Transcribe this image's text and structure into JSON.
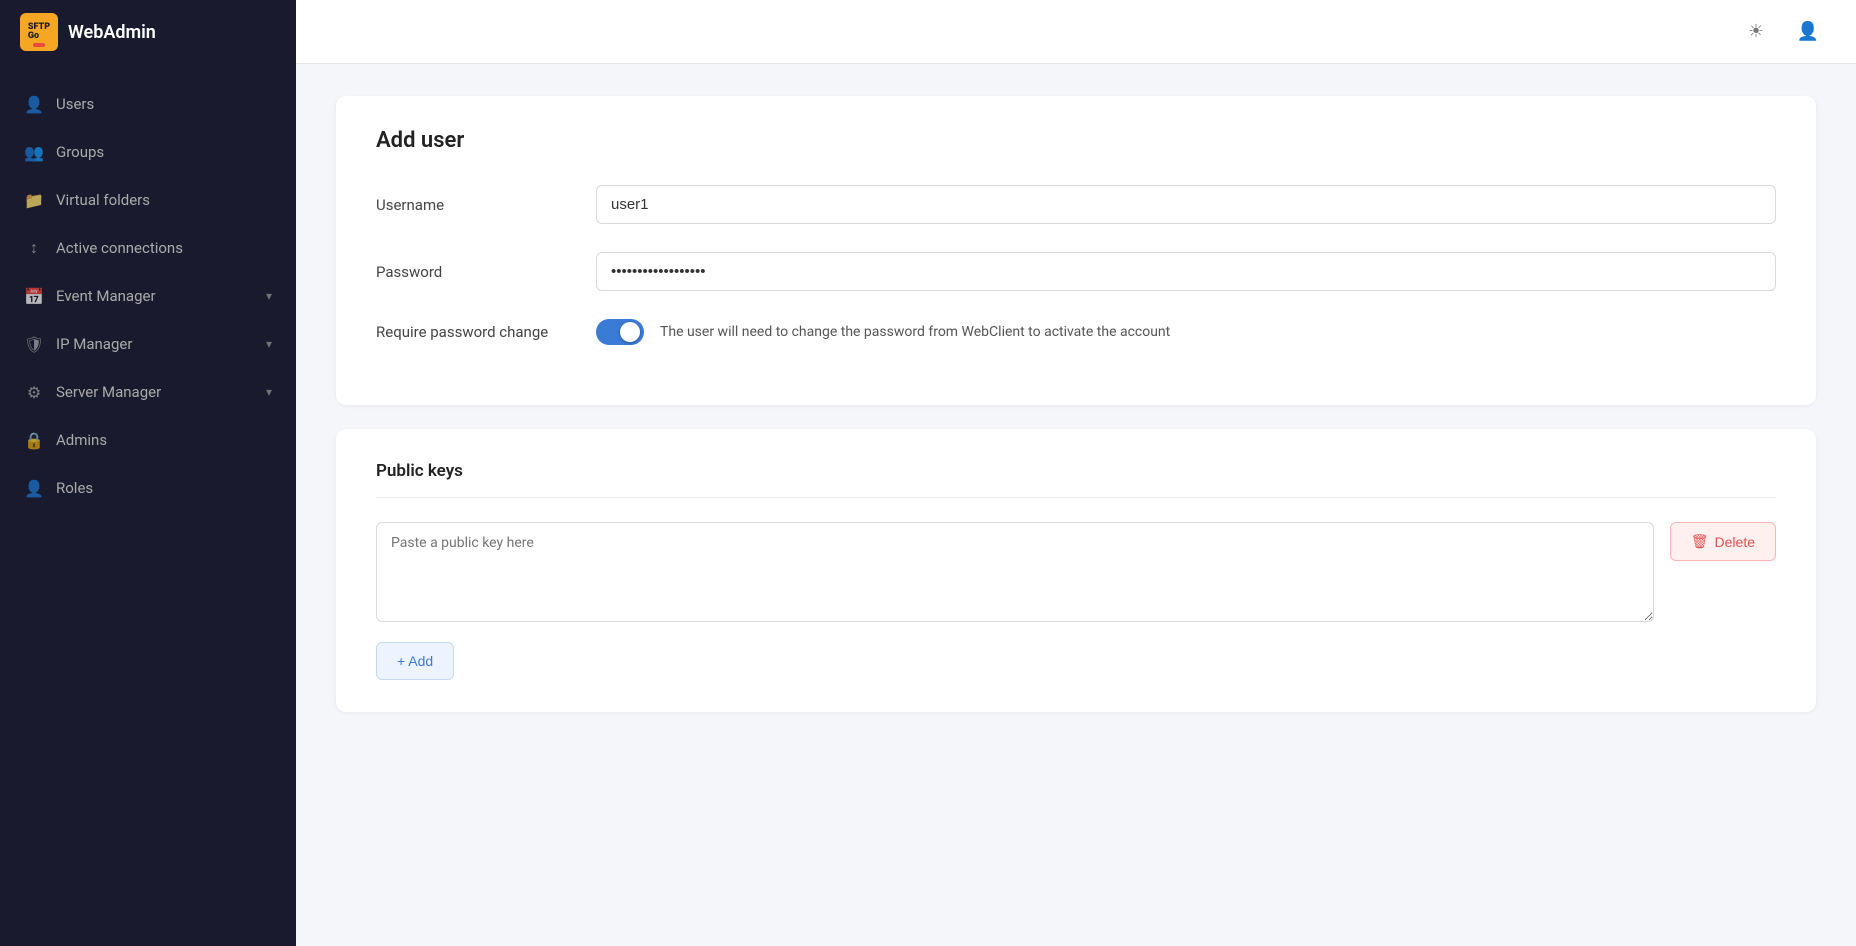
{
  "app": {
    "title": "WebAdmin",
    "logo_text": "SFTPGo"
  },
  "sidebar": {
    "items": [
      {
        "id": "users",
        "label": "Users",
        "icon": "👤"
      },
      {
        "id": "groups",
        "label": "Groups",
        "icon": "👥"
      },
      {
        "id": "virtual-folders",
        "label": "Virtual folders",
        "icon": "📁"
      },
      {
        "id": "active-connections",
        "label": "Active connections",
        "icon": "↕"
      },
      {
        "id": "event-manager",
        "label": "Event Manager",
        "icon": "📅",
        "has_chevron": true
      },
      {
        "id": "ip-manager",
        "label": "IP Manager",
        "icon": "🛡",
        "has_chevron": true
      },
      {
        "id": "server-manager",
        "label": "Server Manager",
        "icon": "⚙",
        "has_chevron": true
      },
      {
        "id": "admins",
        "label": "Admins",
        "icon": "🔒"
      },
      {
        "id": "roles",
        "label": "Roles",
        "icon": "👤"
      }
    ]
  },
  "topbar": {
    "theme_icon": "☀",
    "user_icon": "👤"
  },
  "form": {
    "page_title": "Add user",
    "username_label": "Username",
    "username_value": "user1",
    "password_label": "Password",
    "password_value": "••••••••••••••••••",
    "require_password_label": "Require password change",
    "require_password_description": "The user will need to change the password from WebClient to activate the account",
    "require_password_enabled": true,
    "public_keys_title": "Public keys",
    "public_key_placeholder": "Paste a public key here",
    "delete_label": "Delete",
    "add_label": "+ Add"
  }
}
